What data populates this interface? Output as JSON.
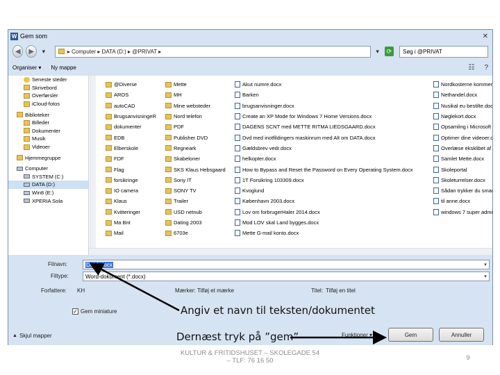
{
  "dialog": {
    "title": "Gem som",
    "title_icon": "W",
    "close": "✕",
    "address": "▸ Computer ▸ DATA (D:) ▸ @PRIVAT ▸",
    "search_placeholder": "Søg i @PRIVAT"
  },
  "toolbar": {
    "organize": "Organiser ▾",
    "new_folder": "Ny mappe"
  },
  "navpane": [
    {
      "label": "Seneste steder",
      "icon": "star"
    },
    {
      "label": "Skrivebord",
      "icon": "fold"
    },
    {
      "label": "Overførsler",
      "icon": "fold"
    },
    {
      "label": "iCloud-fotos",
      "icon": "fold"
    },
    {
      "label": "Biblioteker",
      "icon": "fold",
      "hdr": true
    },
    {
      "label": "Billeder",
      "icon": "fold"
    },
    {
      "label": "Dokumenter",
      "icon": "fold"
    },
    {
      "label": "Musik",
      "icon": "fold"
    },
    {
      "label": "Videoer",
      "icon": "fold"
    },
    {
      "label": "Hjemmegruppe",
      "icon": "fold",
      "hdr": true
    },
    {
      "label": "Computer",
      "icon": "drive",
      "hdr": true
    },
    {
      "label": "SYSTEM (C:)",
      "icon": "drive"
    },
    {
      "label": "DATA (D:)",
      "icon": "drive",
      "sel": true
    },
    {
      "label": "Win8 (E:)",
      "icon": "drive"
    },
    {
      "label": "XPERIA Sola",
      "icon": "drive"
    }
  ],
  "columns": [
    [
      "@Diverse",
      "AROS",
      "autoCAD",
      "BrugsanvisningeR",
      "dokumenter",
      "EDB",
      "Elberskole",
      "FDF",
      "Flag",
      "forsikringe",
      "IO camera",
      "Klaus",
      "Kvitteringer",
      "Ma Bnt",
      "Mail"
    ],
    [
      "Mette",
      "MH",
      "Mine websteder",
      "Nord telefon",
      "PDF",
      "Publisher DVD",
      "Regneark",
      "Skabeloner",
      "SKS Klaus Hebsgaard",
      "Sony IT",
      "SONY TV",
      "Trailer",
      "USD netnub",
      "Dating 2003",
      "6703e"
    ],
    [
      "Akut numre.docx",
      "Barken",
      "brugsanvisninger.docx",
      "Create an XP Mode for Windows 7 Home Versions.docx",
      "DAGENS SCNT med METTE RITMA LIEDSGAARD.docx",
      "Dvd med inotfildingers maskinrum med Alt om DATA.docx",
      "Gældsbrev vedr.docx",
      "helkopter.docx",
      "How to Bypass and Reset the Password on Every Operating System.docx",
      "1T Forsikring 103309.docx",
      "Kvoglund",
      "København 2003.docx",
      "Lov om forbrugerHaler 2014.docx",
      "Mod LOV skal Land bygges.docx",
      "Mette G-mail konto.docx"
    ],
    [
      "Nordkosterne kommer d",
      "Nethandel.docx",
      "Nusikal eu bestilte.docx",
      "Nøglekort.docx",
      "Opsamling i Microsoft O",
      "Optimer dine videoer.do",
      "Overlæse eksklibet af",
      "Samlet Mette.docx",
      "Skoleportal",
      "Skoleturrelser.docx",
      "Sådan trykker du smart",
      "til anne.docx",
      "windows 7 super admin",
      "",
      ""
    ]
  ],
  "form": {
    "filename_label": "Filnavn:",
    "filename_value": "Dok1.docx",
    "filetype_label": "Filtype:",
    "filetype_value": "Word-dokument (*.docx)",
    "authors_label": "Forfattere:",
    "authors_value": "KH",
    "tags_label": "Mærker:",
    "tags_value": "Tilføj et mærke",
    "titel_label": "Titel:",
    "titel_value": "Tilføj en titel",
    "thumb_label": "Gem miniature",
    "hide_folders": "Skjul mapper",
    "tools": "Funktioner ▾",
    "save": "Gem",
    "cancel": "Annuller"
  },
  "annotations": {
    "name_hint": "Angiv et navn til teksten/dokumentet",
    "save_hint": "Dernæst tryk på ”gem”"
  },
  "footer": {
    "line1": "KULTUR & FRITIDSHUSET – SKOLEGADE 54",
    "line2": "– TLF: 76 16 50",
    "page": "9"
  }
}
